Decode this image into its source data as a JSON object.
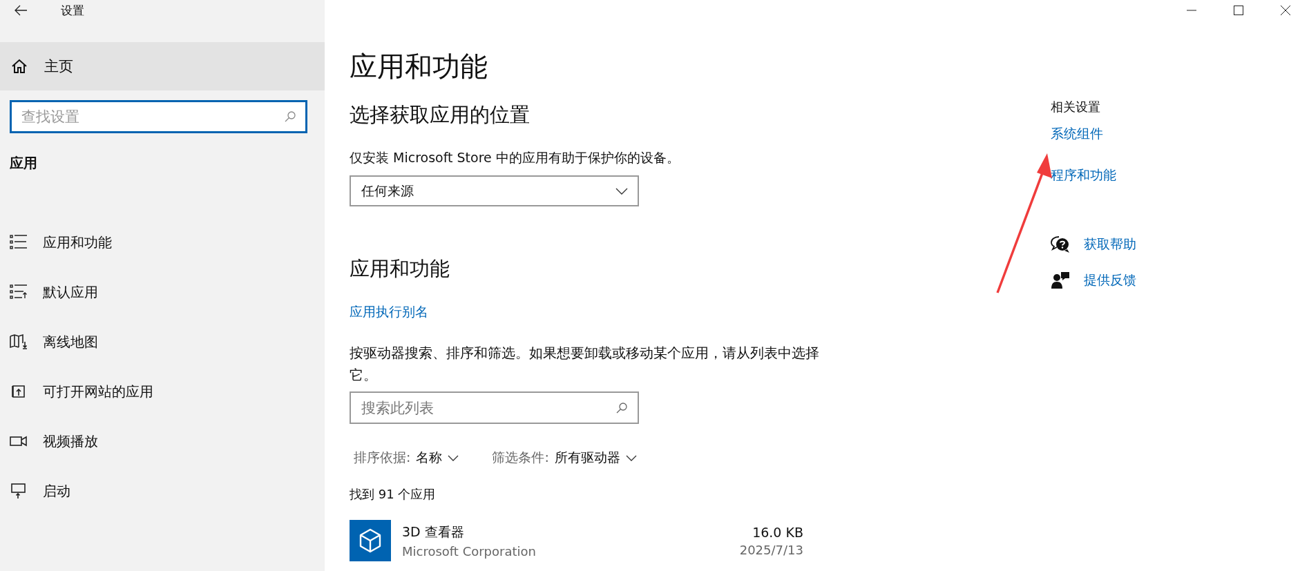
{
  "window": {
    "title": "设置"
  },
  "sidebar": {
    "home": {
      "label": "主页",
      "highlighted": true
    },
    "search": {
      "placeholder": "查找设置"
    },
    "section": "应用",
    "items": [
      {
        "label": "应用和功能"
      },
      {
        "label": "默认应用"
      },
      {
        "label": "离线地图"
      },
      {
        "label": "可打开网站的应用"
      },
      {
        "label": "视频播放"
      },
      {
        "label": "启动"
      }
    ]
  },
  "main": {
    "title": "应用和功能",
    "source": {
      "heading": "选择获取应用的位置",
      "description": "仅安装 Microsoft Store 中的应用有助于保护你的设备。",
      "dropdown": "任何来源"
    },
    "apps": {
      "heading": "应用和功能",
      "link": "应用执行别名",
      "description": "按驱动器搜索、排序和筛选。如果想要卸载或移动某个应用，请从列表中选择它。",
      "search": {
        "placeholder": "搜索此列表"
      },
      "sort": {
        "label": "排序依据:",
        "value": "名称"
      },
      "filter": {
        "label": "筛选条件:",
        "value": "所有驱动器"
      },
      "count": "找到 91 个应用",
      "list": [
        {
          "name": "3D 查看器",
          "publisher": "Microsoft Corporation",
          "size": "16.0 KB",
          "date": "2025/7/13"
        }
      ]
    }
  },
  "related": {
    "heading": "相关设置",
    "links": [
      "系统组件",
      "程序和功能"
    ],
    "support": [
      {
        "kind": "help",
        "label": "获取帮助"
      },
      {
        "kind": "feedback",
        "label": "提供反馈"
      }
    ]
  }
}
